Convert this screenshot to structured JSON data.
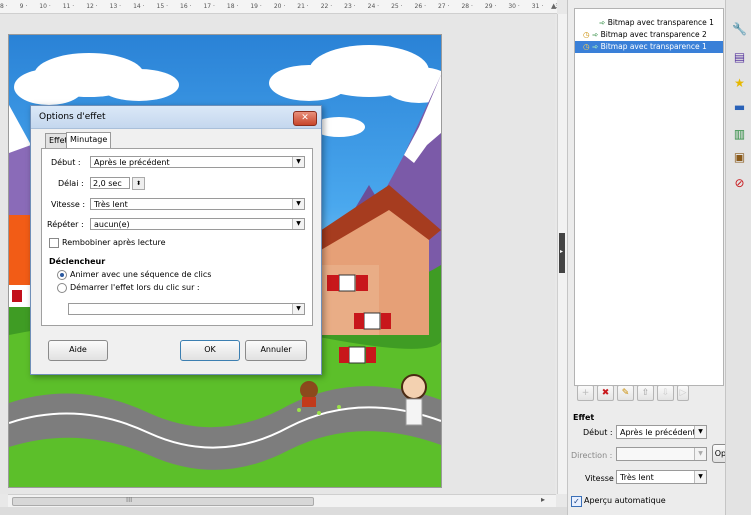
{
  "ruler": {
    "ticks": [
      "8",
      "9",
      "10",
      "11",
      "12",
      "13",
      "14",
      "15",
      "16",
      "17",
      "18",
      "19",
      "20",
      "21",
      "22",
      "23",
      "24",
      "25",
      "26",
      "27",
      "28",
      "29",
      "30",
      "31",
      "32",
      "33"
    ]
  },
  "dialog": {
    "title": "Options d'effet",
    "close_glyph": "✕",
    "tabs": [
      "Effet",
      "Minutage"
    ],
    "start_label": "Début :",
    "start_value": "Après le précédent",
    "delay_label": "Délai :",
    "delay_value": "2,0 sec",
    "speed_label": "Vitesse :",
    "speed_value": "Très lent",
    "repeat_label": "Répéter :",
    "repeat_value": "aucun(e)",
    "rewind_label": "Rembobiner après lecture",
    "trigger_heading": "Déclencheur",
    "trigger_option1": "Animer avec une séquence de clics",
    "trigger_option2": "Démarrer l'effet lors du clic sur :",
    "trigger_target_value": "",
    "help_button": "Aide",
    "ok_button": "OK",
    "cancel_button": "Annuler"
  },
  "animation_list": {
    "items": [
      {
        "label": "Bitmap avec transparence 1",
        "selected": false
      },
      {
        "label": "Bitmap avec transparence 2",
        "selected": false
      },
      {
        "label": "Bitmap avec transparence 1",
        "selected": true
      }
    ]
  },
  "effect_panel": {
    "heading": "Effet",
    "start_label": "Début :",
    "start_value": "Après le précédent",
    "direction_label": "Direction :",
    "direction_value": "",
    "options_button": "Opt",
    "speed_label": "Vitesse :",
    "speed_value": "Très lent",
    "autopreview_label": "Aperçu automatique",
    "autopreview_checked": true
  },
  "scroll": {
    "grip": "III"
  },
  "colors": {
    "selection": "#3a80d8",
    "dialog_title": "#c4d7ee",
    "sky": "#4aa8ee",
    "grass": "#5cbf2a"
  }
}
